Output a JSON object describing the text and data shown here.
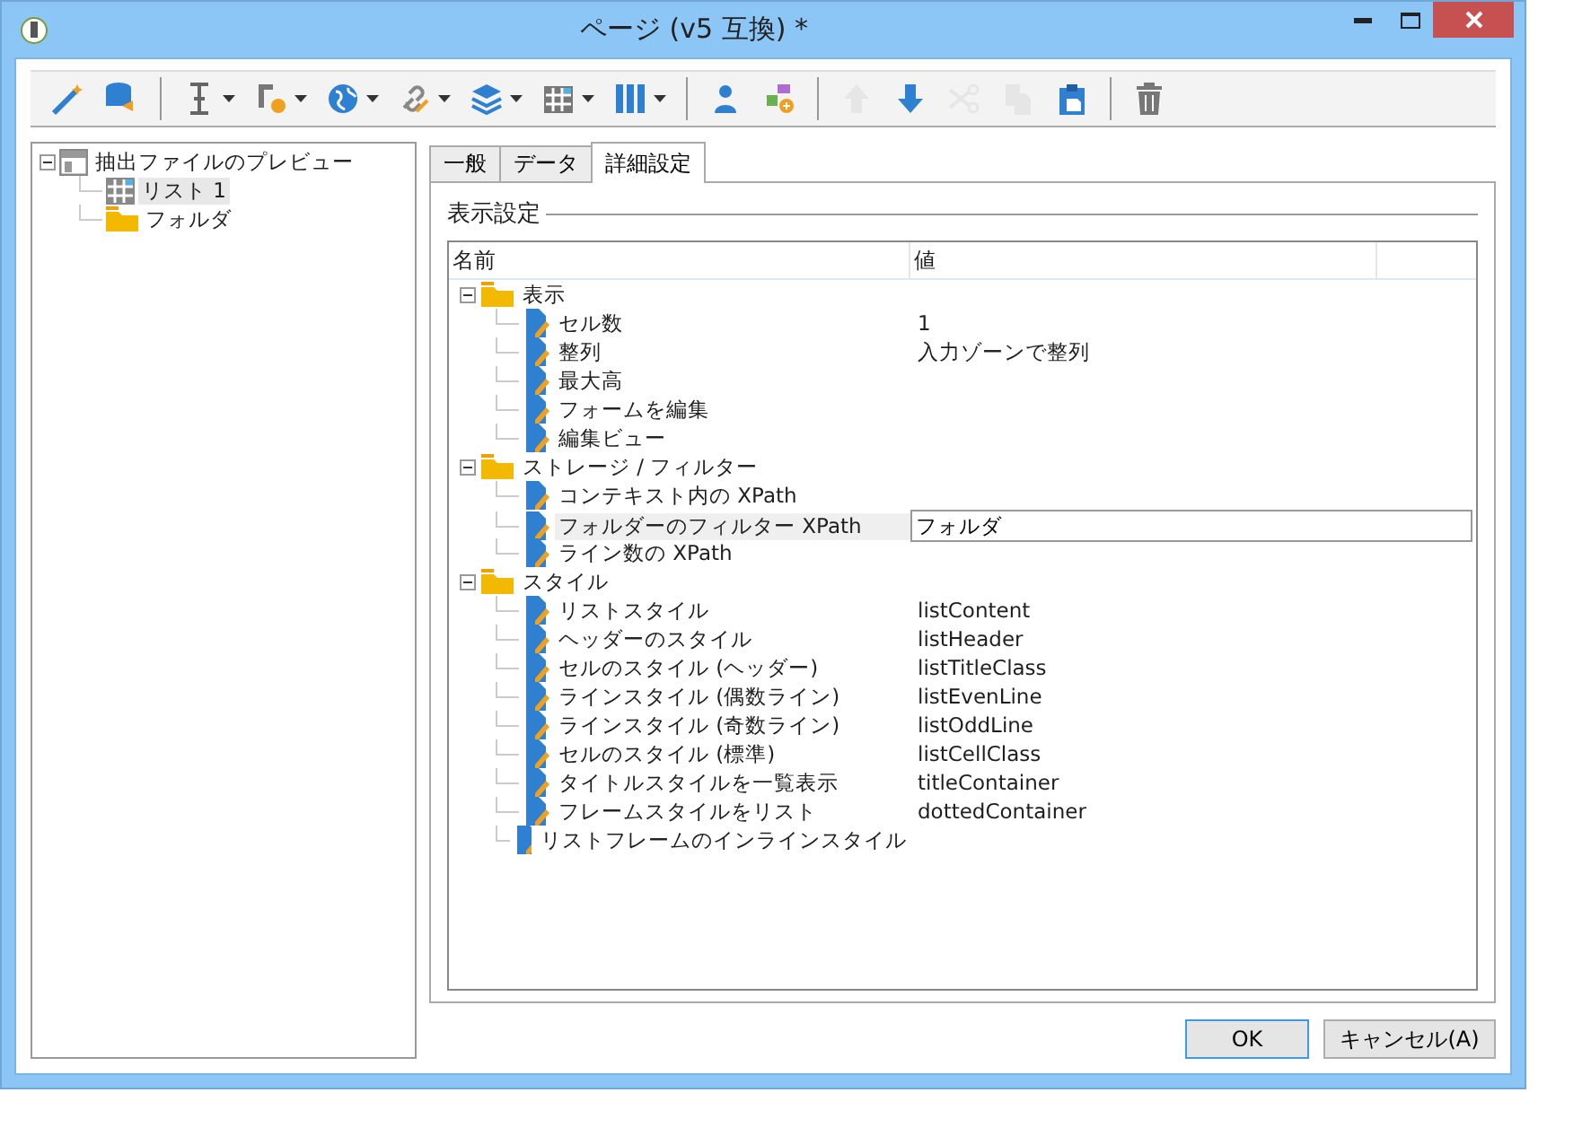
{
  "window": {
    "title": "ページ (v5 互換) *"
  },
  "toolbar": [
    [
      {
        "has_menu": false,
        "disabled": false
      },
      {
        "has_menu": false,
        "disabled": false
      }
    ],
    [
      {
        "has_menu": true,
        "disabled": false
      },
      {
        "has_menu": true,
        "disabled": false
      },
      {
        "has_menu": true,
        "disabled": false
      },
      {
        "has_menu": true,
        "disabled": false
      },
      {
        "has_menu": true,
        "disabled": false
      },
      {
        "has_menu": true,
        "disabled": false
      },
      {
        "has_menu": true,
        "disabled": false
      }
    ],
    [
      {
        "has_menu": false,
        "disabled": false
      },
      {
        "has_menu": false,
        "disabled": false
      }
    ],
    [
      {
        "has_menu": false,
        "disabled": true
      },
      {
        "has_menu": false,
        "disabled": false
      },
      {
        "has_menu": false,
        "disabled": true
      },
      {
        "has_menu": false,
        "disabled": true
      },
      {
        "has_menu": false,
        "disabled": false
      }
    ],
    [
      {
        "has_menu": false,
        "disabled": false
      }
    ]
  ],
  "sidebar": {
    "tree": [
      {
        "label": "抽出ファイルのプレビュー",
        "kind": "page",
        "expanded": true,
        "selected": false,
        "children": [
          {
            "label": "リスト 1",
            "kind": "list",
            "selected": true
          },
          {
            "label": "フォルダ",
            "kind": "folder",
            "selected": false
          }
        ]
      }
    ]
  },
  "tabs": [
    {
      "label": "一般",
      "selected": false
    },
    {
      "label": "データ",
      "selected": false
    },
    {
      "label": "詳細設定",
      "selected": true
    }
  ],
  "group_title": "表示設定",
  "table": {
    "columns": [
      "名前",
      "値"
    ],
    "groups": [
      {
        "label": "表示",
        "expanded": true,
        "children": [
          {
            "name": "セル数",
            "value": "1",
            "selected": false,
            "editing": false
          },
          {
            "name": "整列",
            "value": "入力ゾーンで整列",
            "selected": false,
            "editing": false
          },
          {
            "name": "最大高",
            "selected": false,
            "editing": false
          },
          {
            "name": "フォームを編集",
            "selected": false,
            "editing": false
          },
          {
            "name": "編集ビュー",
            "selected": false,
            "editing": false
          }
        ]
      },
      {
        "label": "ストレージ / フィルター",
        "expanded": true,
        "children": [
          {
            "name": "コンテキスト内の XPath",
            "selected": false,
            "editing": false
          },
          {
            "name": "フォルダーのフィルター XPath",
            "value": "フォルダ",
            "selected": true,
            "editing": true
          },
          {
            "name": "ライン数の XPath",
            "selected": false,
            "editing": false
          }
        ]
      },
      {
        "label": "スタイル",
        "expanded": true,
        "children": [
          {
            "name": "リストスタイル",
            "value": "listContent",
            "selected": false,
            "editing": false
          },
          {
            "name": "ヘッダーのスタイル",
            "value": "listHeader",
            "selected": false,
            "editing": false
          },
          {
            "name": "セルのスタイル (ヘッダー)",
            "value": "listTitleClass",
            "selected": false,
            "editing": false
          },
          {
            "name": "ラインスタイル (偶数ライン)",
            "value": "listEvenLine",
            "selected": false,
            "editing": false
          },
          {
            "name": "ラインスタイル (奇数ライン)",
            "value": "listOddLine",
            "selected": false,
            "editing": false
          },
          {
            "name": "セルのスタイル (標準)",
            "value": "listCellClass",
            "selected": false,
            "editing": false
          },
          {
            "name": "タイトルスタイルを一覧表示",
            "value": "titleContainer",
            "selected": false,
            "editing": false
          },
          {
            "name": "フレームスタイルをリスト",
            "value": "dottedContainer",
            "selected": false,
            "editing": false
          },
          {
            "name": "リストフレームのインラインスタイル",
            "selected": false,
            "editing": false
          }
        ]
      }
    ]
  },
  "buttons": [
    {
      "label": "OK",
      "default": true
    },
    {
      "label": "キャンセル(A)",
      "default": false
    }
  ]
}
